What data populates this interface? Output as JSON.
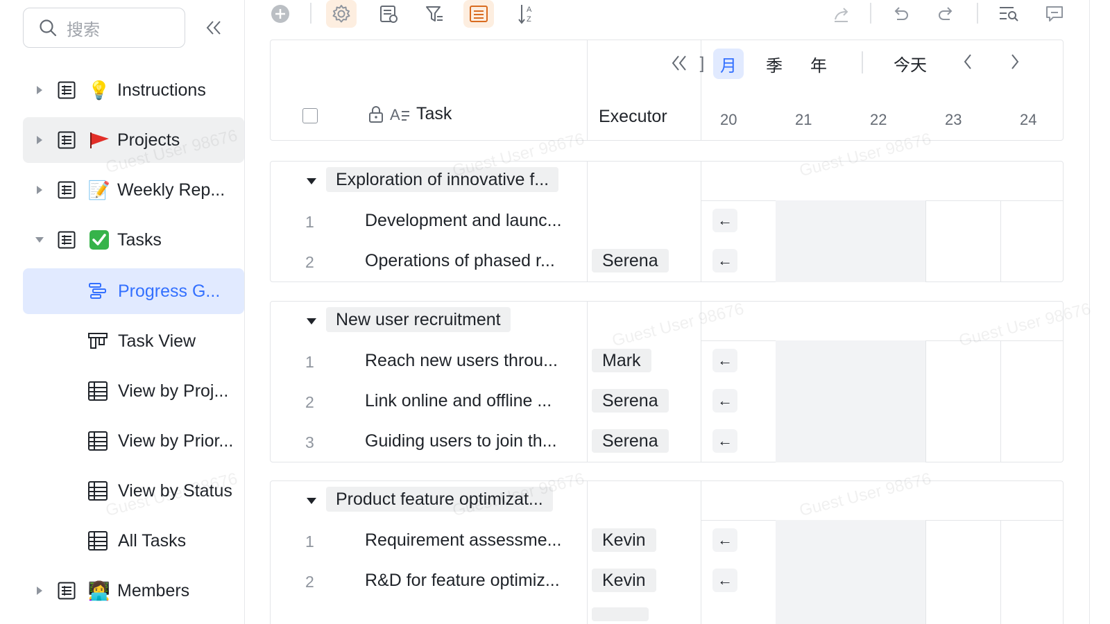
{
  "sidebar": {
    "search_placeholder": "搜索",
    "items": [
      {
        "label": "Instructions",
        "emoji": "💡"
      },
      {
        "label": "Projects",
        "emoji": "🚩"
      },
      {
        "label": "Weekly Rep...",
        "emoji": "📝"
      },
      {
        "label": "Tasks",
        "emoji": "✅"
      }
    ],
    "views": [
      {
        "label": "Progress G..."
      },
      {
        "label": "Task View"
      },
      {
        "label": "View by Proj..."
      },
      {
        "label": "View by Prior..."
      },
      {
        "label": "View by Status"
      },
      {
        "label": "All Tasks"
      }
    ],
    "members": {
      "label": "Members",
      "emoji": "👩‍💻"
    }
  },
  "header": {
    "task_label": "Task",
    "executor_label": "Executor"
  },
  "timeline": {
    "units": [
      "月",
      "季",
      "年"
    ],
    "partial_unit": "]",
    "active_unit": "月",
    "today": "今天",
    "days": [
      "20",
      "21",
      "22",
      "23",
      "24"
    ]
  },
  "groups": [
    {
      "title": "Exploration of innovative f...",
      "tasks": [
        {
          "num": "1",
          "name": "Development and launc...",
          "executor": ""
        },
        {
          "num": "2",
          "name": "Operations of phased r...",
          "executor": "Serena"
        }
      ]
    },
    {
      "title": "New user recruitment",
      "tasks": [
        {
          "num": "1",
          "name": "Reach new users throu...",
          "executor": "Mark"
        },
        {
          "num": "2",
          "name": "Link online and offline ...",
          "executor": "Serena"
        },
        {
          "num": "3",
          "name": "Guiding users to join th...",
          "executor": "Serena"
        }
      ]
    },
    {
      "title": "Product feature optimizat...",
      "tasks": [
        {
          "num": "1",
          "name": "Requirement assessme...",
          "executor": "Kevin"
        },
        {
          "num": "2",
          "name": "R&D for feature optimiz...",
          "executor": "Kevin"
        }
      ]
    }
  ],
  "watermark": "Guest User 98676",
  "colors": {
    "accent": "#3370ff",
    "flag": "#e22e28",
    "tag_bg": "#eff0f1",
    "active_tool_bg": "#fdeee0"
  }
}
